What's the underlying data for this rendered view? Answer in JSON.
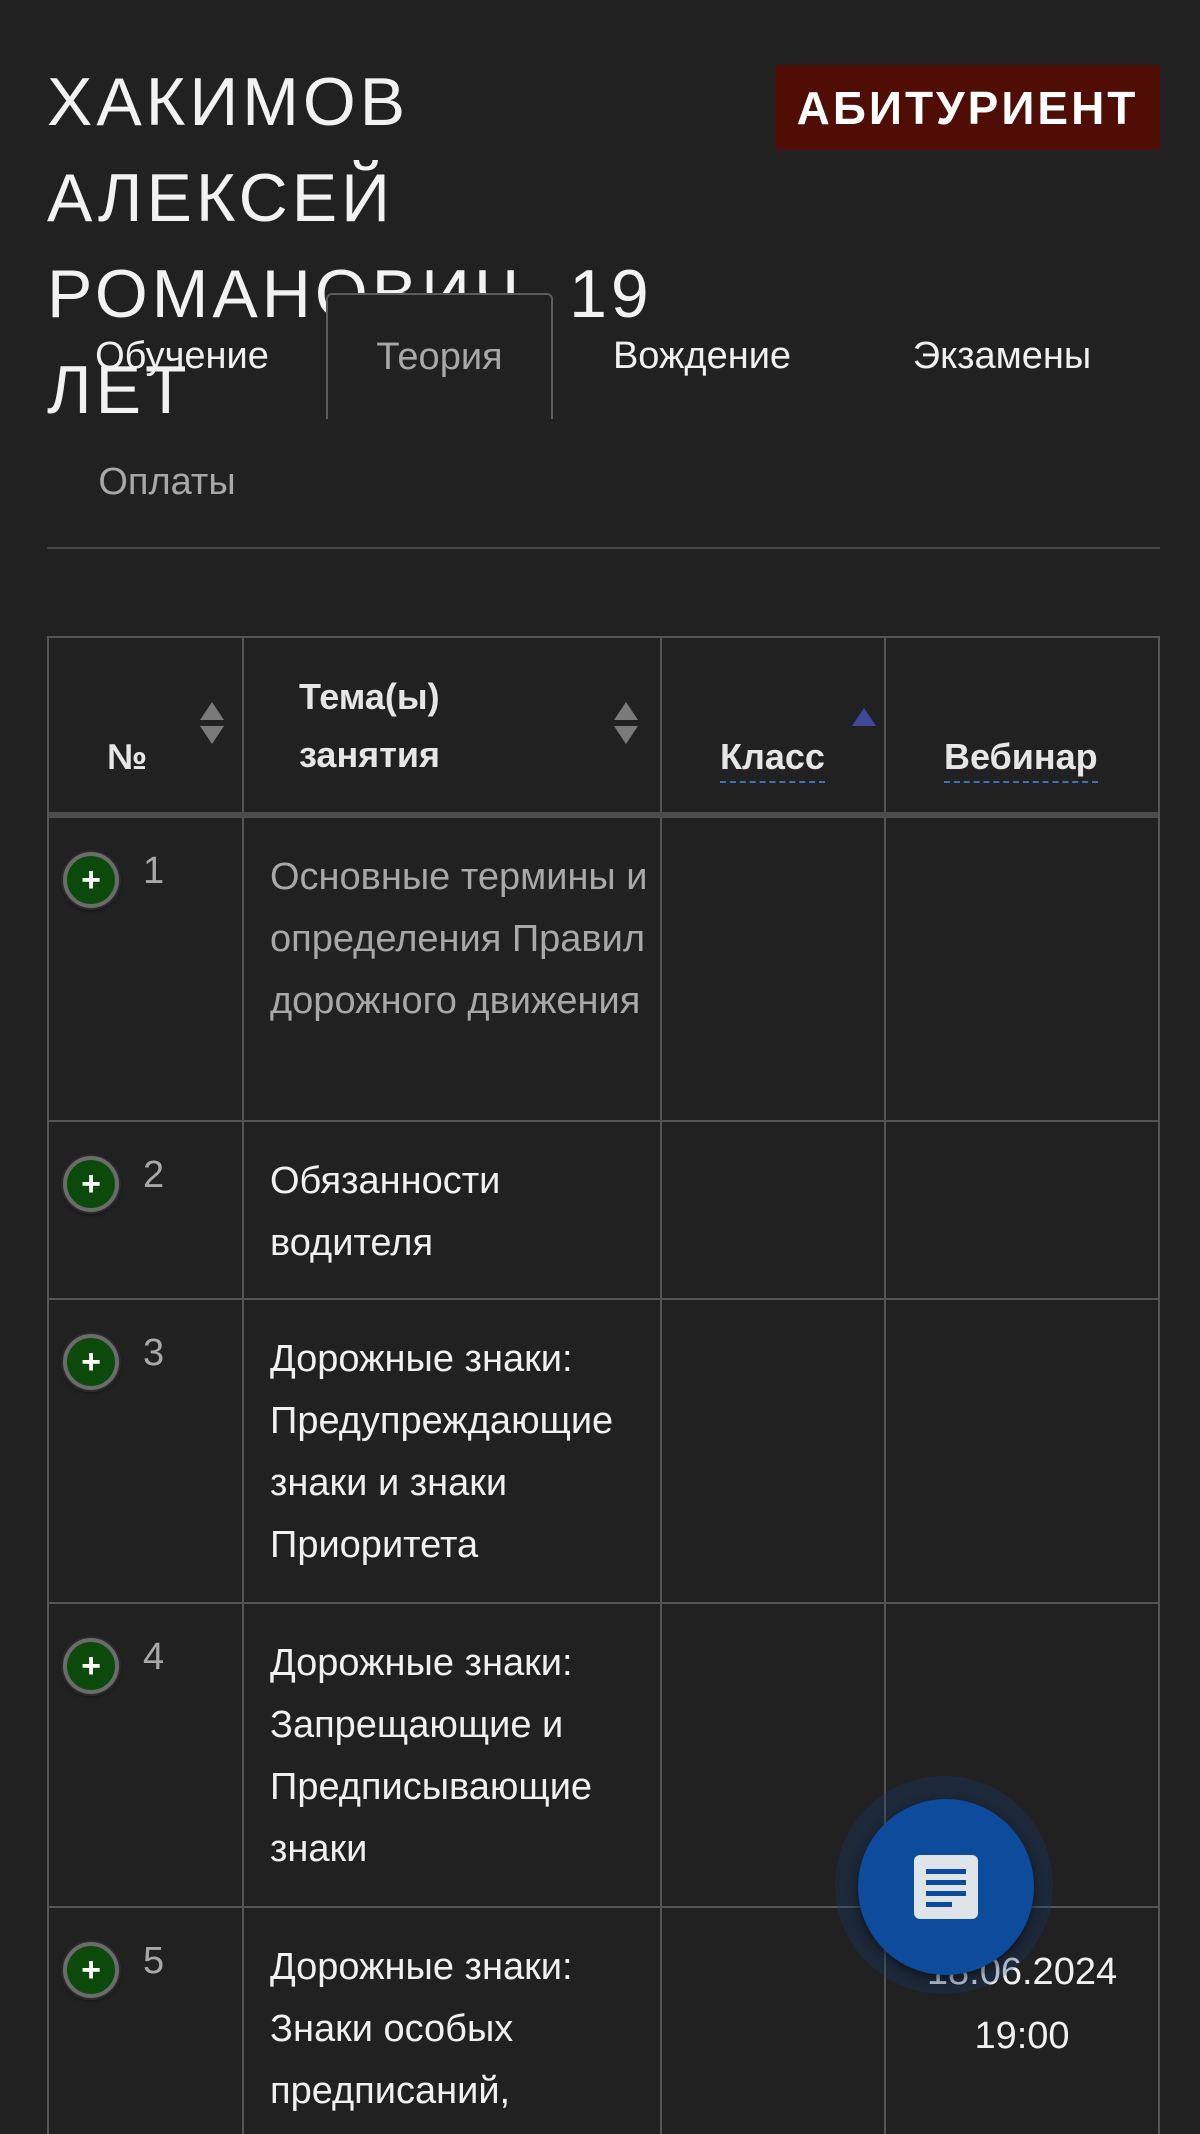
{
  "header": {
    "student_name": "ХАКИМОВ АЛЕКСЕЙ РОМАНОВИЧ, 19 ЛЕТ",
    "status_badge": "АБИТУРИЕНТ"
  },
  "tabs": [
    {
      "label": "Обучение",
      "active": false
    },
    {
      "label": "Теория",
      "active": true
    },
    {
      "label": "Вождение",
      "active": false
    },
    {
      "label": "Экзамены",
      "active": false
    },
    {
      "label": "Оплаты",
      "active": false
    }
  ],
  "table": {
    "columns": {
      "number": "№",
      "topic": "Тема(ы) занятия",
      "class": "Класс",
      "webinar": "Вебинар"
    },
    "rows": [
      {
        "number": "1",
        "topic": "Основные термины и определения Правил дорожного движения",
        "class": "",
        "webinar": ""
      },
      {
        "number": "2",
        "topic": "Обязанности водителя",
        "class": "",
        "webinar": ""
      },
      {
        "number": "3",
        "topic": "Дорожные знаки: Предупреждающие знаки и знаки Приоритета",
        "class": "",
        "webinar": ""
      },
      {
        "number": "4",
        "topic": "Дорожные знаки: Запрещающие и Предписывающие знаки",
        "class": "",
        "webinar": ""
      },
      {
        "number": "5",
        "topic": "Дорожные знаки: Знаки особых предписаний,",
        "class": "",
        "webinar": "18.06.2024 19:00"
      }
    ]
  },
  "icons": {
    "expand": "plus-circle-icon",
    "fab": "document-icon"
  },
  "colors": {
    "background": "#212121",
    "badge": "#4f0d05",
    "expand_button": "#0b4a0b",
    "fab": "#0d4c9c"
  }
}
